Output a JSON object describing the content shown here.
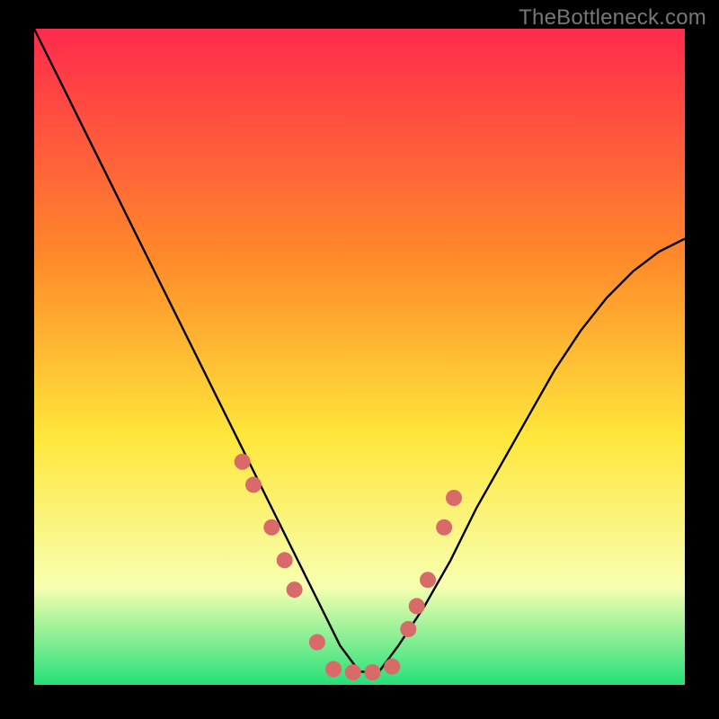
{
  "watermark": "TheBottleneck.com",
  "colors": {
    "frame": "#000000",
    "gradient_top": "#ff2a4d",
    "gradient_mid1": "#ff8a2a",
    "gradient_mid2": "#ffe63a",
    "gradient_mid3": "#f7ffb0",
    "gradient_bottom": "#25e07a",
    "curve": "#000000",
    "dot_fill": "#d86a6a",
    "dot_stroke": "#b24f4f"
  },
  "chart_data": {
    "type": "line",
    "title": "",
    "xlabel": "",
    "ylabel": "",
    "xlim": [
      0,
      100
    ],
    "ylim": [
      0,
      100
    ],
    "series": [
      {
        "name": "bottleneck-curve",
        "x": [
          0,
          4,
          8,
          12,
          16,
          20,
          24,
          28,
          32,
          36,
          40,
          44,
          47,
          50,
          53,
          56,
          60,
          64,
          68,
          72,
          76,
          80,
          84,
          88,
          92,
          96,
          100
        ],
        "y": [
          100,
          92,
          84,
          76,
          68,
          60,
          52,
          44,
          36,
          28,
          20,
          12,
          6,
          2,
          2,
          6,
          12,
          19,
          27,
          34,
          41,
          48,
          54,
          59,
          63,
          66,
          68
        ]
      }
    ],
    "markers": {
      "name": "highlight-dots",
      "x": [
        32.0,
        33.7,
        36.5,
        38.5,
        40.0,
        43.5,
        46.0,
        49.0,
        52.0,
        55.0,
        57.5,
        58.8,
        60.5,
        63.0,
        64.5
      ],
      "y": [
        34.0,
        30.5,
        24.0,
        19.0,
        14.5,
        6.5,
        2.4,
        1.9,
        1.9,
        2.8,
        8.5,
        12.0,
        16.0,
        24.0,
        28.5
      ]
    }
  }
}
